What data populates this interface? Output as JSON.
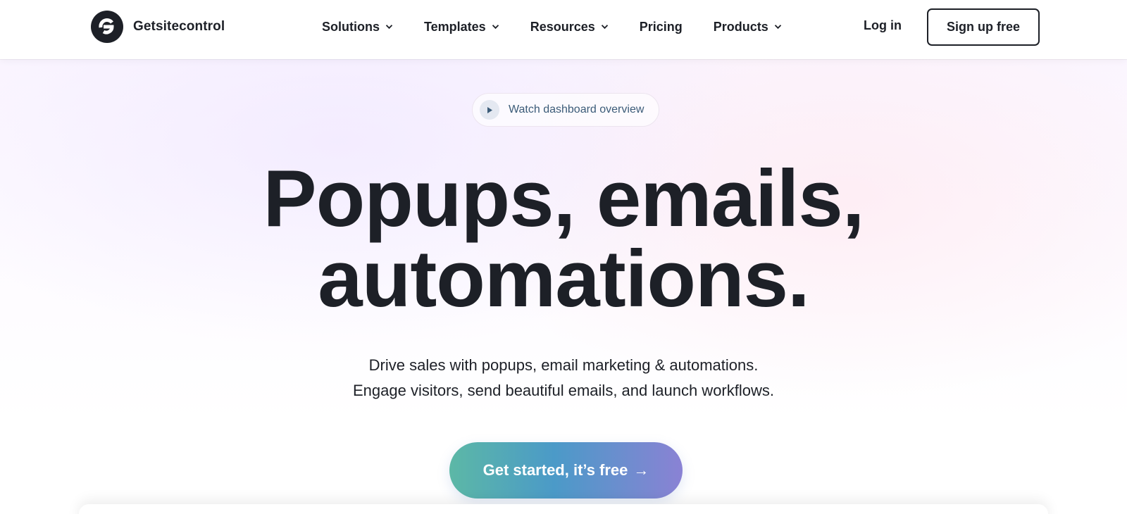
{
  "brand": {
    "name": "Getsitecontrol",
    "logo_icon": "getsitecontrol-logo-icon"
  },
  "nav": {
    "items": [
      {
        "label": "Solutions",
        "has_dropdown": true
      },
      {
        "label": "Templates",
        "has_dropdown": true
      },
      {
        "label": "Resources",
        "has_dropdown": true
      },
      {
        "label": "Pricing",
        "has_dropdown": false
      },
      {
        "label": "Products",
        "has_dropdown": true
      }
    ],
    "login_label": "Log in",
    "signup_label": "Sign up free"
  },
  "hero": {
    "watch_label": "Watch dashboard overview",
    "headline_line1": "Popups, emails,",
    "headline_line2": "automations.",
    "sub_line1": "Drive sales with popups, email marketing & automations.",
    "sub_line2": "Engage visitors, send beautiful emails, and launch workflows.",
    "cta_label": "Get started, it’s free",
    "cta_arrow": "→"
  },
  "colors": {
    "text": "#1d2027",
    "watch_text": "#3b5b78",
    "cta_gradient_start": "#5cb8a6",
    "cta_gradient_end": "#8a82d4"
  }
}
